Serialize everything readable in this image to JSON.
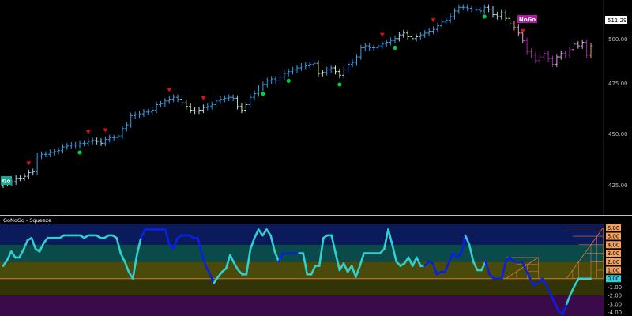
{
  "chart_data": [
    {
      "type": "ohlc",
      "panel": "price",
      "y_ticks": [
        "425.00",
        "450.00",
        "475.00",
        "500.00"
      ],
      "ylim": [
        413,
        530
      ],
      "last_price_label": "511.29",
      "badges": {
        "go": "Go",
        "nogo": "NoGo"
      },
      "colors": {
        "go_strong": "#3d9be3",
        "go_weak": "#a9d6ea",
        "go_neutral": "#cfe8b8",
        "nogo_strong": "#9c2aa7",
        "nogo_weak": "#d7a7dc",
        "amber": "#f0a060",
        "up_arrow": "#00d040",
        "down_arrow": "#e01010",
        "nogo_arrow": "#00c030"
      },
      "closes": [
        430,
        430.5,
        431,
        433,
        433,
        434,
        436,
        436.5,
        445,
        446,
        446,
        447,
        447.5,
        448,
        450,
        450.5,
        451,
        451,
        452,
        452,
        453,
        453.5,
        453,
        452,
        454,
        455,
        455,
        456,
        460,
        462,
        467,
        467.5,
        468,
        469,
        469,
        470,
        473,
        473.5,
        475,
        476,
        477,
        476,
        474,
        472,
        470,
        469.5,
        470,
        471.5,
        472,
        473,
        475,
        476,
        476.5,
        477,
        476.5,
        472,
        470,
        473,
        477,
        479,
        482,
        484,
        486,
        487,
        486,
        488,
        490,
        491,
        492,
        493,
        494,
        494.5,
        495,
        495.5,
        490,
        490.5,
        492,
        493,
        491,
        489,
        492,
        495,
        496,
        499,
        504,
        505,
        504,
        504,
        505,
        506,
        507,
        508,
        509,
        511,
        512,
        510,
        509,
        510,
        511,
        512,
        513,
        514,
        516,
        518,
        519,
        521,
        524,
        526,
        526,
        525.5,
        525,
        524.5,
        524,
        526,
        525,
        522,
        521,
        523,
        520,
        517,
        515,
        512,
        508,
        502,
        500,
        497,
        499,
        501,
        498,
        495,
        499,
        501,
        500,
        503,
        506,
        505,
        507,
        500,
        505
      ],
      "bar_colors": [
        "go_weak",
        "go_weak",
        "go_weak",
        "go_weak",
        "go_weak",
        "go_weak",
        "go_weak",
        "go_weak",
        "go_strong",
        "go_strong",
        "go_strong",
        "go_strong",
        "go_strong",
        "go_strong",
        "go_strong",
        "go_strong",
        "go_strong",
        "go_strong",
        "go_strong",
        "go_strong",
        "go_strong",
        "go_strong",
        "go_weak",
        "go_weak",
        "go_strong",
        "go_strong",
        "go_strong",
        "go_strong",
        "go_strong",
        "go_strong",
        "go_strong",
        "go_strong",
        "go_strong",
        "go_strong",
        "go_strong",
        "go_strong",
        "go_strong",
        "go_strong",
        "go_strong",
        "go_strong",
        "go_strong",
        "go_strong",
        "go_weak",
        "go_neutral",
        "go_neutral",
        "go_neutral",
        "go_weak",
        "go_weak",
        "go_strong",
        "go_strong",
        "go_strong",
        "go_strong",
        "go_strong",
        "go_strong",
        "go_strong",
        "go_weak",
        "go_neutral",
        "go_weak",
        "go_strong",
        "go_strong",
        "go_strong",
        "go_strong",
        "go_strong",
        "go_strong",
        "go_strong",
        "go_strong",
        "go_strong",
        "go_strong",
        "go_strong",
        "go_strong",
        "go_strong",
        "go_strong",
        "go_strong",
        "go_strong",
        "go_neutral",
        "go_neutral",
        "go_strong",
        "go_strong",
        "go_neutral",
        "go_neutral",
        "go_weak",
        "go_strong",
        "go_strong",
        "go_strong",
        "go_strong",
        "go_strong",
        "go_strong",
        "go_strong",
        "go_strong",
        "go_strong",
        "go_strong",
        "go_strong",
        "go_strong",
        "go_weak",
        "go_weak",
        "go_neutral",
        "go_neutral",
        "go_weak",
        "go_strong",
        "go_strong",
        "go_strong",
        "go_strong",
        "go_strong",
        "go_strong",
        "go_strong",
        "go_strong",
        "go_strong",
        "go_strong",
        "go_strong",
        "go_strong",
        "go_strong",
        "go_strong",
        "go_strong",
        "go_strong",
        "go_weak",
        "go_weak",
        "go_weak",
        "go_neutral",
        "go_neutral",
        "go_neutral",
        "amber",
        "nogo_weak",
        "nogo_weak",
        "nogo_strong",
        "nogo_strong",
        "nogo_strong",
        "nogo_strong",
        "nogo_strong",
        "nogo_strong",
        "nogo_strong",
        "nogo_weak",
        "nogo_weak",
        "nogo_strong",
        "nogo_strong",
        "nogo_weak",
        "nogo_weak",
        "nogo_weak",
        "nogo_strong",
        "amber"
      ],
      "go_arrows_up": [
        18,
        61,
        67,
        79,
        92,
        113
      ],
      "go_arrows_down": [
        6,
        20,
        24,
        39,
        47,
        89,
        101,
        122
      ],
      "nogo_arrows_up": [
        139
      ]
    },
    {
      "type": "line",
      "panel": "oscillator",
      "title": "GoNoGo - Squeeze",
      "ylim": [
        -4.4,
        6.4
      ],
      "right_labels": [
        {
          "text": "6.00",
          "value": 6,
          "color": "#f0a060",
          "text_color": "#000000"
        },
        {
          "text": "5.00",
          "value": 5,
          "color": "#f0a060",
          "text_color": "#000000"
        },
        {
          "text": "4.00",
          "value": 4,
          "color": "#f0a060",
          "text_color": "#000000"
        },
        {
          "text": "3.00",
          "value": 3,
          "color": "#f0a060",
          "text_color": "#000000"
        },
        {
          "text": "2.00",
          "value": 2,
          "color": "#f0a060",
          "text_color": "#000000"
        },
        {
          "text": "1.00",
          "value": 1,
          "color": "#f0a060",
          "text_color": "#000000"
        },
        {
          "text": "0.00",
          "value": 0,
          "color": "#28d0d8",
          "text_color": "#000000"
        }
      ],
      "neg_labels": [
        {
          "text": "-1.00",
          "value": -1
        },
        {
          "text": "-2.00",
          "value": -2
        },
        {
          "text": "-3.00",
          "value": -3
        },
        {
          "text": "-4.00",
          "value": -4
        }
      ],
      "bands": [
        {
          "from": 4,
          "to": 6.4,
          "color": "#0a1a5a"
        },
        {
          "from": 2,
          "to": 4,
          "color": "#0a4a4a"
        },
        {
          "from": 0,
          "to": 2,
          "color": "#4a4a0a"
        },
        {
          "from": -2,
          "to": 0,
          "color": "#333308"
        },
        {
          "from": -4.4,
          "to": -2,
          "color": "#3a0a4a"
        }
      ],
      "colors": {
        "strong": "#0a20e0",
        "weak": "#30d0d0",
        "zero_line": "#d08020",
        "squeeze": "#e07830"
      },
      "values": [
        1.5,
        2.2,
        3.2,
        2.5,
        2.5,
        3.4,
        4.5,
        4.8,
        3.5,
        3.2,
        4.2,
        4.8,
        4.8,
        4.8,
        4.8,
        5.1,
        5.1,
        5.1,
        5.1,
        5.1,
        4.8,
        5.1,
        5.1,
        5.1,
        4.8,
        4.8,
        5.1,
        5.1,
        4.8,
        3.0,
        2.0,
        0.8,
        0.0,
        2.8,
        4.8,
        5.8,
        5.8,
        5.8,
        5.8,
        5.8,
        5.8,
        4.0,
        3.5,
        4.8,
        5.1,
        5.1,
        5.1,
        4.8,
        4.8,
        3.0,
        1.5,
        0.5,
        -0.5,
        0.2,
        0.8,
        1.2,
        2.8,
        1.8,
        1.0,
        0.5,
        0.5,
        3.5,
        4.8,
        5.8,
        5.1,
        5.8,
        5.1,
        3.2,
        2.0,
        3.0,
        3.0,
        3.0,
        3.0,
        3.0,
        3.0,
        0.5,
        0.5,
        1.5,
        1.5,
        4.8,
        5.1,
        5.1,
        3.0,
        1.0,
        1.8,
        0.8,
        1.5,
        0.2,
        1.5,
        3.0,
        3.0,
        3.0,
        3.0,
        3.0,
        3.5,
        5.8,
        4.0,
        2.0,
        1.5,
        1.8,
        2.5,
        1.5,
        2.5,
        1.5,
        1.5,
        2.0,
        1.8,
        0.5,
        0.8,
        0.8,
        2.0,
        3.0,
        2.5,
        3.0,
        5.1,
        4.0,
        2.0,
        1.0,
        1.0,
        2.0,
        0.5,
        0.0,
        0.0,
        0.0,
        2.0,
        2.5,
        2.0,
        2.0,
        2.0,
        1.0,
        0.0,
        -0.8,
        -0.5,
        0.0,
        -0.8,
        -1.8,
        -2.8,
        -3.8,
        -4.2,
        -3.0,
        -1.8,
        -0.8,
        0.0,
        0.0,
        0.0,
        0.0
      ],
      "line_colors": [
        "weak",
        "weak",
        "weak",
        "weak",
        "weak",
        "weak",
        "weak",
        "weak",
        "weak",
        "weak",
        "weak",
        "weak",
        "weak",
        "weak",
        "weak",
        "weak",
        "weak",
        "weak",
        "weak",
        "weak",
        "weak",
        "weak",
        "weak",
        "weak",
        "weak",
        "weak",
        "weak",
        "weak",
        "weak",
        "weak",
        "weak",
        "weak",
        "weak",
        "weak",
        "weak",
        "strong",
        "strong",
        "strong",
        "strong",
        "strong",
        "strong",
        "strong",
        "strong",
        "strong",
        "strong",
        "strong",
        "strong",
        "strong",
        "strong",
        "strong",
        "strong",
        "strong",
        "strong",
        "weak",
        "weak",
        "weak",
        "weak",
        "weak",
        "weak",
        "weak",
        "weak",
        "weak",
        "weak",
        "weak",
        "weak",
        "weak",
        "weak",
        "weak",
        "weak",
        "strong",
        "strong",
        "strong",
        "strong",
        "strong",
        "weak",
        "weak",
        "weak",
        "weak",
        "weak",
        "weak",
        "weak",
        "weak",
        "weak",
        "weak",
        "weak",
        "weak",
        "weak",
        "weak",
        "weak",
        "weak",
        "weak",
        "weak",
        "weak",
        "weak",
        "weak",
        "weak",
        "weak",
        "weak",
        "weak",
        "weak",
        "weak",
        "weak",
        "weak",
        "weak",
        "weak",
        "strong",
        "strong",
        "strong",
        "strong",
        "strong",
        "strong",
        "strong",
        "strong",
        "strong",
        "strong",
        "weak",
        "weak",
        "weak",
        "weak",
        "weak",
        "strong",
        "strong",
        "strong",
        "strong",
        "strong",
        "strong",
        "strong",
        "strong",
        "strong",
        "strong",
        "strong",
        "strong",
        "strong",
        "strong",
        "strong",
        "strong",
        "strong",
        "strong",
        "strong",
        "strong",
        "weak",
        "weak",
        "weak",
        "weak",
        "weak",
        "weak",
        "weak",
        "weak"
      ],
      "squeeze_grids": [
        {
          "from": 124,
          "to": 132,
          "max_value": 2.5
        },
        {
          "from": 139,
          "to": 148,
          "max_value": 6.0
        }
      ]
    }
  ]
}
